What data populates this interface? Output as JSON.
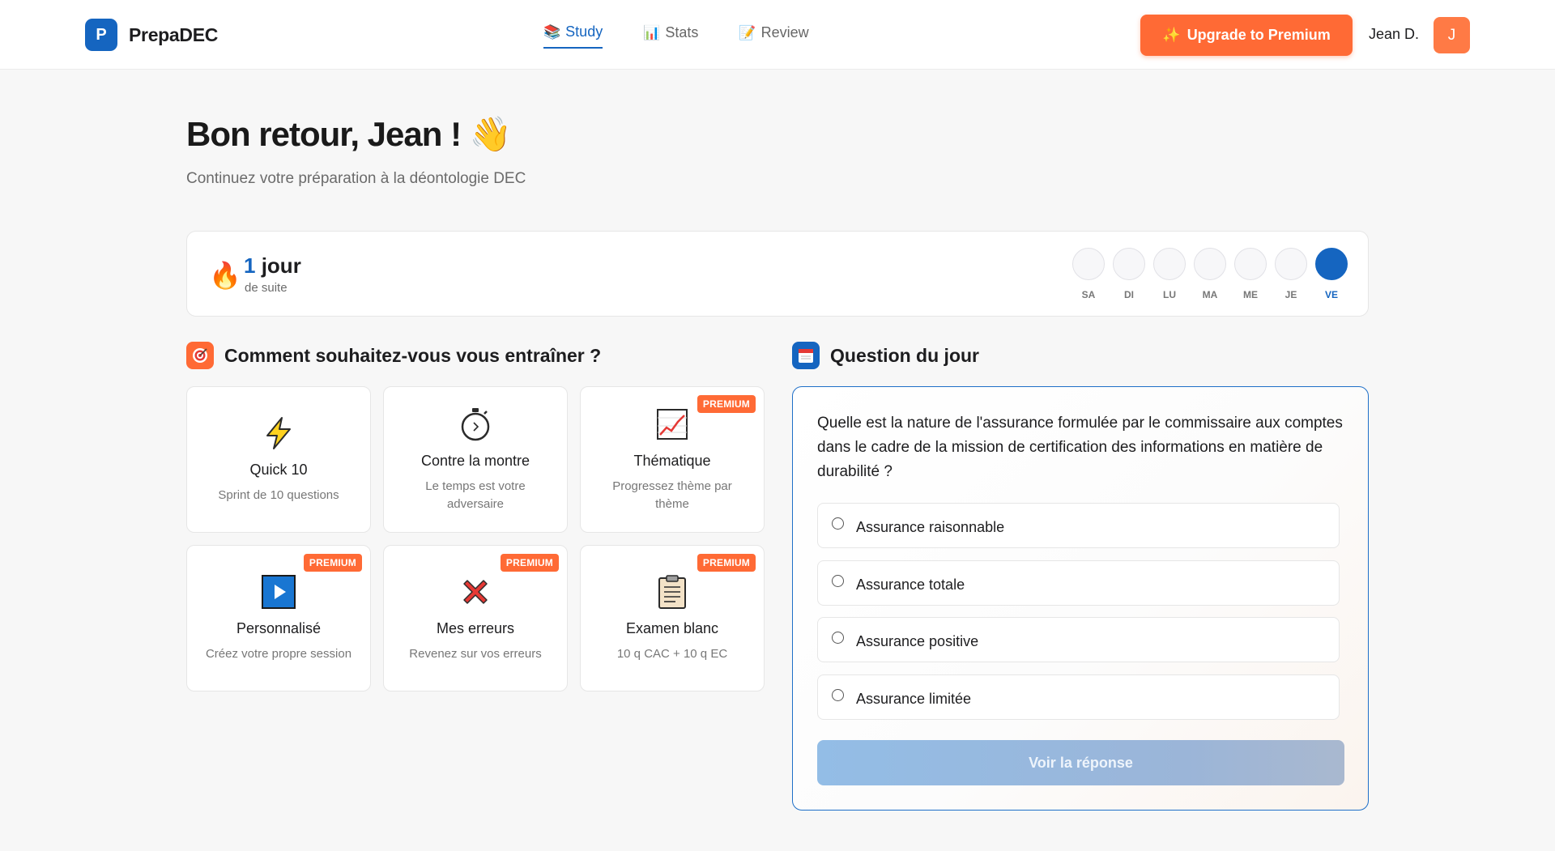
{
  "header": {
    "brand_letter": "P",
    "brand_name": "PrepaDEC",
    "nav": [
      {
        "label": "Study",
        "icon": "books-icon",
        "active": true
      },
      {
        "label": "Stats",
        "icon": "bar-chart-icon",
        "active": false
      },
      {
        "label": "Review",
        "icon": "pencil-icon",
        "active": false
      }
    ],
    "upgrade_label": "Upgrade to Premium",
    "user_name": "Jean D.",
    "avatar_letter": "J"
  },
  "greeting": {
    "title": "Bon retour, Jean !",
    "subtitle": "Continuez votre préparation à la déontologie DEC"
  },
  "streak": {
    "count": "1",
    "unit": "jour",
    "label": "de suite",
    "days": [
      "SA",
      "DI",
      "LU",
      "MA",
      "ME",
      "JE",
      "VE"
    ],
    "active_day": "VE"
  },
  "training": {
    "title": "Comment souhaitez-vous vous entraîner ?",
    "modes": [
      {
        "title": "Quick 10",
        "desc": "Sprint de 10 questions",
        "premium": false,
        "icon": "lightning-icon"
      },
      {
        "title": "Contre la montre",
        "desc": "Le temps est votre adversaire",
        "premium": false,
        "icon": "stopwatch-icon"
      },
      {
        "title": "Thématique",
        "desc": "Progressez thème par thème",
        "premium": true,
        "icon": "trend-chart-icon"
      },
      {
        "title": "Personnalisé",
        "desc": "Créez votre propre session",
        "premium": true,
        "icon": "play-button-icon"
      },
      {
        "title": "Mes erreurs",
        "desc": "Revenez sur vos erreurs",
        "premium": true,
        "icon": "cross-mark-icon"
      },
      {
        "title": "Examen blanc",
        "desc": "10 q CAC + 10 q EC",
        "premium": true,
        "icon": "clipboard-icon"
      }
    ],
    "premium_label": "PREMIUM"
  },
  "question": {
    "section_title": "Question du jour",
    "text": "Quelle est la nature de l'assurance formulée par le commissaire aux comptes dans le cadre de la mission de certification des informations en matière de durabilité ?",
    "options": [
      "Assurance raisonnable",
      "Assurance totale",
      "Assurance positive",
      "Assurance limitée"
    ],
    "reveal_label": "Voir la réponse"
  },
  "colors": {
    "brand_blue": "#1565c0",
    "accent_orange": "#ff6a35",
    "button_disabled": "#93bde6"
  }
}
